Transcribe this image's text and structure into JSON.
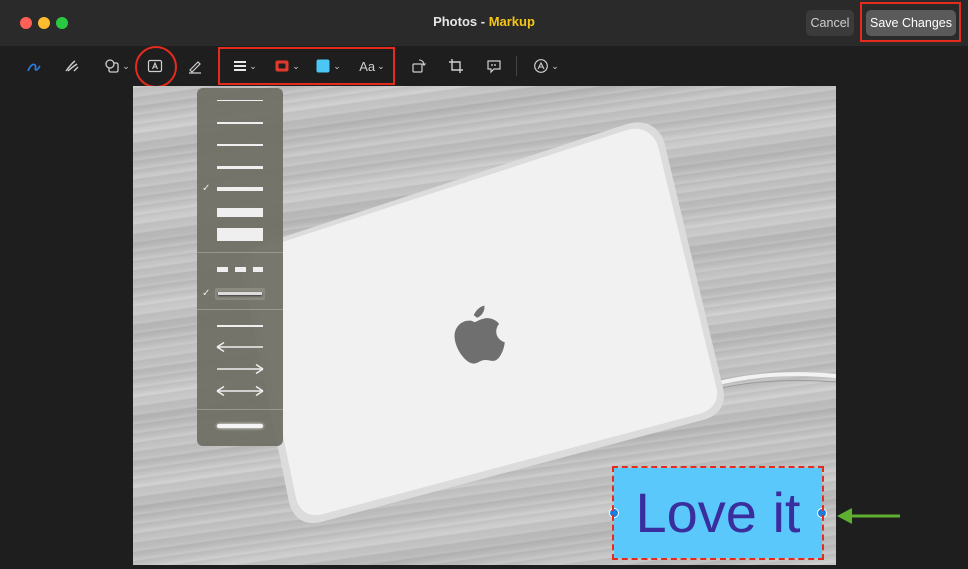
{
  "window": {
    "title_app": "Photos",
    "title_sep": " - ",
    "title_mode": "Markup",
    "cancel_label": "Cancel",
    "save_label": "Save Changes"
  },
  "toolbar": {
    "font_label": "Aa",
    "icons": [
      "sketch-icon",
      "draw-icon",
      "shapes-icon",
      "text-icon",
      "highlight-icon",
      "shape-style-icon",
      "border-color-icon",
      "fill-color-icon",
      "text-style-icon",
      "rotate-icon",
      "crop-icon",
      "annotate-icon",
      "description-icon"
    ]
  },
  "menu": {
    "selected_thickness_index": 4,
    "selected_style": "shadow"
  },
  "canvas": {
    "text_annotation": "Love it",
    "fill_color": "#5ac8fa",
    "text_color": "#3a2d9e",
    "annotation_color": "#e52b1e",
    "arrow_color": "#5fb030"
  }
}
